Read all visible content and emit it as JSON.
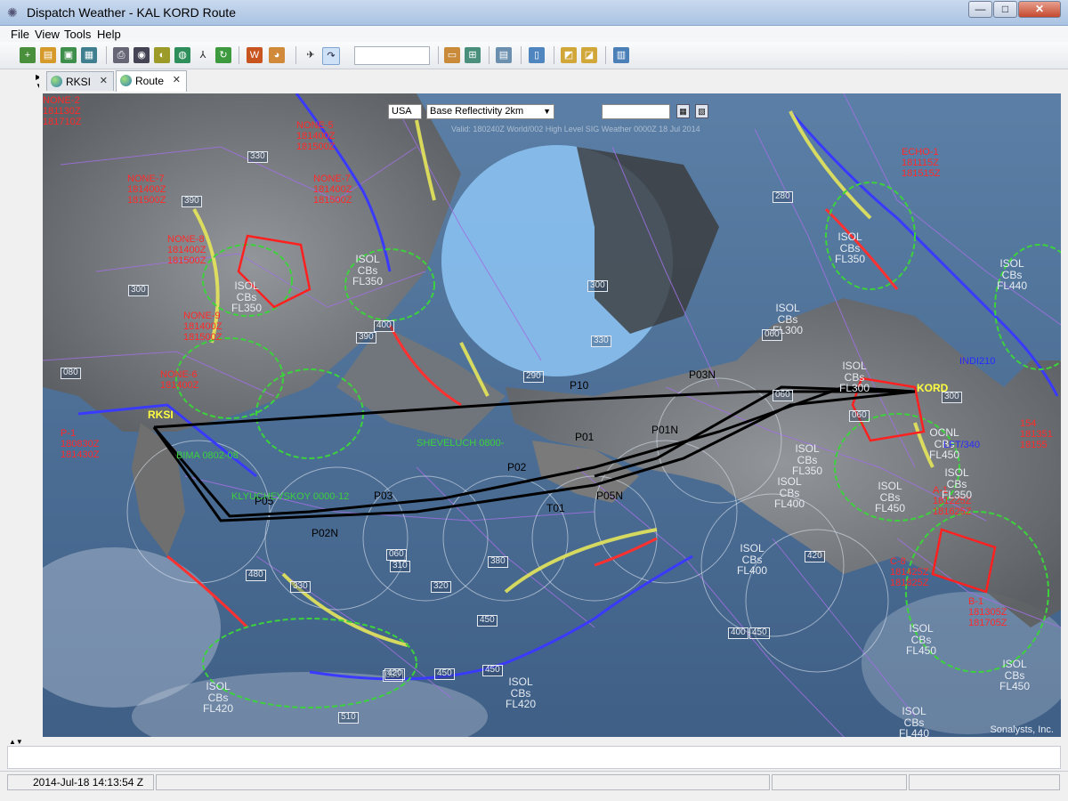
{
  "window": {
    "title": "Dispatch Weather - KAL KORD Route",
    "minimize": "—",
    "maximize": "□",
    "close": "✕"
  },
  "menu": [
    "File",
    "View",
    "Tools",
    "Help"
  ],
  "tabs": [
    {
      "label": "RKSI",
      "close": "✕",
      "active": false
    },
    {
      "label": "Route",
      "close": "✕",
      "active": true
    }
  ],
  "map": {
    "region_select": "USA",
    "product_select": "Base Reflectivity 2km",
    "header_caption": "Valid: 180240Z World/002 High Level SIG Weather 0000Z 18 Jul 2014",
    "credit": "Sonalysts, Inc.",
    "airports": [
      {
        "code": "RKSI",
        "color": "#ffff40"
      },
      {
        "code": "KORD",
        "color": "#ffff40"
      }
    ],
    "waypoints": [
      "P10",
      "P01",
      "P01N",
      "P03N",
      "P02",
      "P05N",
      "T01",
      "P03",
      "P05",
      "P02N"
    ],
    "advisories": [
      {
        "label": "NONE-2",
        "lines": [
          "181130Z",
          "181710Z"
        ]
      },
      {
        "label": "NONE-5",
        "lines": [
          "181400Z",
          "181500Z"
        ]
      },
      {
        "label": "NONE-7",
        "lines": [
          "181400Z",
          "181500Z"
        ]
      },
      {
        "label": "NONE-7",
        "lines": [
          "181400Z",
          "181500Z"
        ]
      },
      {
        "label": "NONE-8",
        "lines": [
          "181400Z",
          "181500Z"
        ]
      },
      {
        "label": "NONE-9",
        "lines": [
          "181400Z",
          "181500Z"
        ]
      },
      {
        "label": "NONE-6",
        "lines": [
          "181400Z"
        ]
      },
      {
        "label": "P-1",
        "lines": [
          "180830Z",
          "181430Z"
        ]
      },
      {
        "label": "ECHO-1",
        "lines": [
          "181115Z",
          "181515Z"
        ]
      },
      {
        "label": "A-1",
        "lines": [
          "181225Z",
          "181625Z"
        ]
      },
      {
        "label": "C-8",
        "lines": [
          "181425Z",
          "181825Z"
        ]
      },
      {
        "label": "B-1",
        "lines": [
          "181305Z",
          "181705Z"
        ]
      },
      {
        "label": "154",
        "lines": [
          "181351",
          "18155"
        ]
      }
    ],
    "cb_areas": [
      {
        "lines": [
          "ISOL",
          "CBs",
          "FL350"
        ]
      },
      {
        "lines": [
          "ISOL",
          "CBs",
          "FL350"
        ]
      },
      {
        "lines": [
          "ISOL",
          "CBs",
          "FL350"
        ]
      },
      {
        "lines": [
          "ISOL",
          "CBs",
          "FL350"
        ]
      },
      {
        "lines": [
          "ISOL",
          "CBs",
          "FL400"
        ]
      },
      {
        "lines": [
          "ISOL",
          "CBs",
          "FL400"
        ]
      },
      {
        "lines": [
          "ISOL",
          "CBs",
          "FL450"
        ]
      },
      {
        "lines": [
          "ISOL",
          "CBs",
          "FL450"
        ]
      },
      {
        "lines": [
          "ISOL",
          "CBs",
          "FL450"
        ]
      },
      {
        "lines": [
          "ISOL",
          "CBs",
          "FL420"
        ]
      },
      {
        "lines": [
          "ISOL",
          "CBs",
          "FL420"
        ]
      },
      {
        "lines": [
          "ISOL",
          "CBs",
          "FL440"
        ]
      },
      {
        "lines": [
          "ISOL",
          "CBs",
          "FL440"
        ]
      },
      {
        "lines": [
          "ISOL",
          "CBs",
          "FL300"
        ]
      },
      {
        "lines": [
          "ISOL",
          "CBs",
          "FL300"
        ]
      },
      {
        "lines": [
          "ISOL",
          "CBs",
          "FL350"
        ]
      },
      {
        "lines": [
          "OCNL",
          "CBs",
          "FL450"
        ]
      }
    ],
    "sigmets": [
      "SHEVELUCH 0800-",
      "BIMA 0802-08",
      "KLYUCHEVSKOY 0000-12",
      "LFT/340",
      "INDI210"
    ],
    "flight_levels": [
      "390",
      "300",
      "400",
      "080",
      "300",
      "330",
      "290",
      "280",
      "420",
      "450",
      "330",
      "060",
      "060",
      "450",
      "390",
      "080",
      "420",
      "450",
      "510",
      "480",
      "330",
      "310",
      "060",
      "450",
      "400",
      "380",
      "320",
      "300",
      "060"
    ]
  },
  "status": {
    "datetime": "2014-Jul-18 14:13:54 Z"
  }
}
